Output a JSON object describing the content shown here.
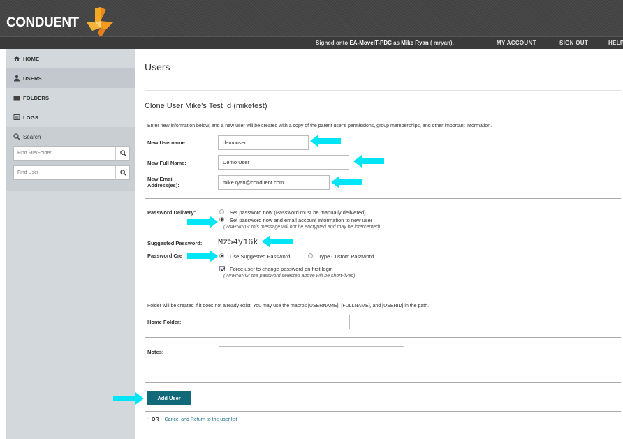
{
  "header": {
    "logo_text": "CONDUENT",
    "signed_prefix": "Signed onto ",
    "host": "EA-MoveIT-PDC",
    "signed_as": " as ",
    "user": "Mike Ryan",
    "user_id": " ( mryan).",
    "my_account": "MY ACCOUNT",
    "sign_out": "SIGN OUT",
    "help": "HELP"
  },
  "sidebar": {
    "items": [
      {
        "label": "HOME",
        "icon": "home-icon"
      },
      {
        "label": "USERS",
        "icon": "user-icon"
      },
      {
        "label": "FOLDERS",
        "icon": "folder-icon"
      },
      {
        "label": "LOGS",
        "icon": "logs-icon"
      }
    ],
    "search": {
      "title": "Search",
      "file_placeholder": "Find File/Folder",
      "user_placeholder": "Find User"
    }
  },
  "main": {
    "title": "Users",
    "clone_title": "Clone User Mike's Test Id (miketest)",
    "intro": "Enter new information below, and a new user will be created with a copy of the parent user's permissions, group memberships, and other important information.",
    "new_username_label": "New Username:",
    "new_username_value": "demouser",
    "full_name_label": "New Full Name:",
    "full_name_value": "Demo User",
    "email_label": "New Email Address(es):",
    "email_value": "mike.ryan@conduent.com",
    "password_delivery_label": "Password Delivery:",
    "delivery_option_1": "Set password now (Password must be manually delivered)",
    "delivery_option_2": "Set password now and email account information to new user",
    "delivery_warning": "(WARNING: this message will not be encrypted and may be intercepted)",
    "suggested_password_label": "Suggested Password:",
    "suggested_password_value": "Mz54y16k",
    "password_creation_label": "Password Cre",
    "creation_option_1": "Use Suggested Password",
    "creation_option_2": "Type Custom Password",
    "force_change_label": "Force user to change password on first login",
    "force_change_warning": "(WARNING: the password selected above will be short-lived)",
    "folder_note": "Folder will be created if it does not already exist. You may use the macros [USERNAME], [FULLNAME], and [USERID] in the path.",
    "home_folder_label": "Home Folder:",
    "home_folder_value": "",
    "notes_label": "Notes:",
    "add_user_button": "Add User",
    "or_text": "~ OR ~",
    "cancel_link": "Cancel and Return to the user list"
  },
  "colors": {
    "header_bg": "#444444",
    "sidebar_bg": "#d3d8dc",
    "button_teal": "#12697a",
    "arrow_cyan": "#00e5f5",
    "logo_orange": "#f59b23"
  }
}
